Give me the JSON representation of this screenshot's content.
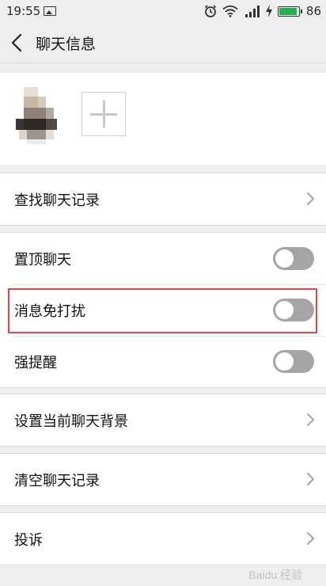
{
  "status_bar": {
    "time": "19:55",
    "signal_type": "4G",
    "battery_level": 86,
    "battery_text": "86",
    "battery_color": "#22b14c"
  },
  "header": {
    "title": "聊天信息",
    "back_icon": "chevron-left-icon"
  },
  "members": {
    "add_icon": "plus-icon"
  },
  "sections": {
    "search": {
      "label": "查找聊天记录"
    },
    "toggles": [
      {
        "label": "置顶聊天",
        "on": false
      },
      {
        "label": "消息免打扰",
        "on": false,
        "highlighted": true
      },
      {
        "label": "强提醒",
        "on": false
      }
    ],
    "background": {
      "label": "设置当前聊天背景"
    },
    "clear": {
      "label": "清空聊天记录"
    },
    "report": {
      "label": "投诉"
    }
  },
  "colors": {
    "highlight": "#e5454b",
    "toggle_off": "#a5a5a5"
  },
  "watermark": "Baidu 经验"
}
